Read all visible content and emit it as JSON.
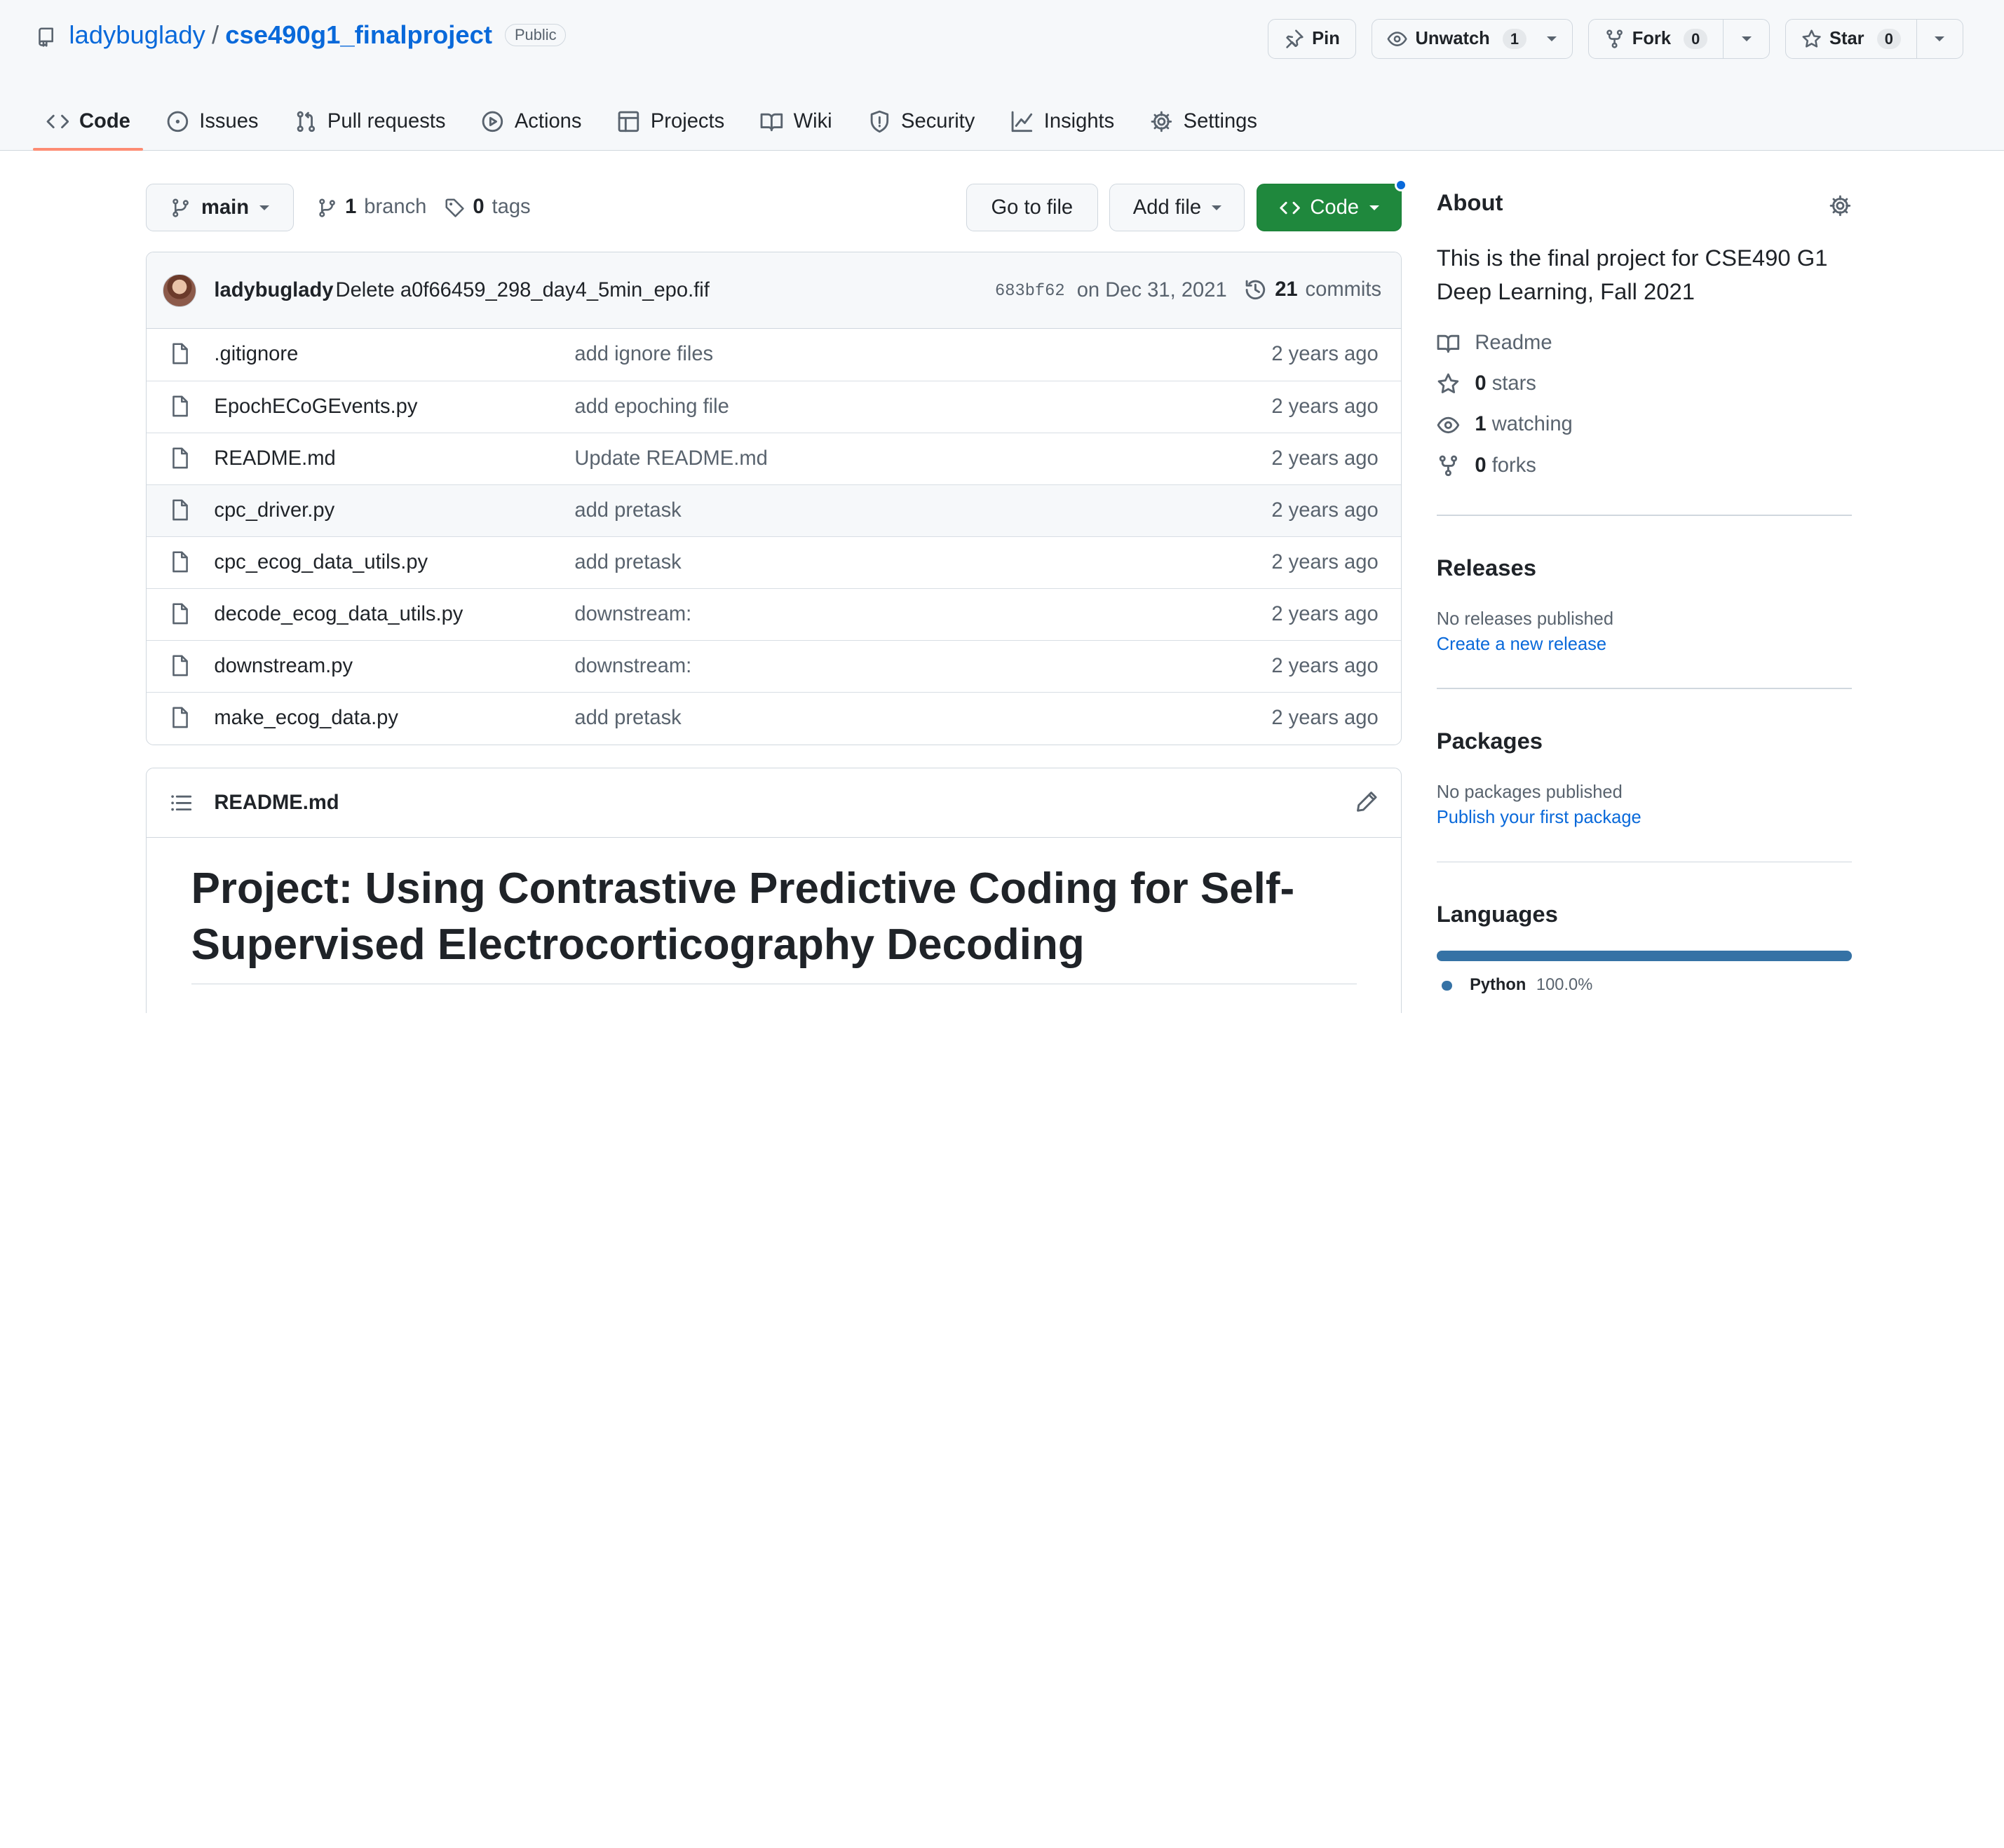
{
  "repo": {
    "owner": "ladybuglady",
    "separator": "/",
    "name": "cse490g1_finalproject",
    "visibility": "Public"
  },
  "actions": {
    "pin": "Pin",
    "unwatch": "Unwatch",
    "unwatch_count": "1",
    "fork": "Fork",
    "fork_count": "0",
    "star": "Star",
    "star_count": "0"
  },
  "tabs": [
    {
      "label": "Code",
      "icon": "code-icon",
      "active": true
    },
    {
      "label": "Issues",
      "icon": "issue-icon"
    },
    {
      "label": "Pull requests",
      "icon": "pull-request-icon"
    },
    {
      "label": "Actions",
      "icon": "play-icon"
    },
    {
      "label": "Projects",
      "icon": "table-icon"
    },
    {
      "label": "Wiki",
      "icon": "book-icon"
    },
    {
      "label": "Security",
      "icon": "shield-icon"
    },
    {
      "label": "Insights",
      "icon": "graph-icon"
    },
    {
      "label": "Settings",
      "icon": "gear-icon"
    }
  ],
  "branchbar": {
    "branch": "main",
    "branch_count": "1",
    "branch_label": "branch",
    "tag_count": "0",
    "tag_label": "tags",
    "goto_file": "Go to file",
    "add_file": "Add file",
    "code": "Code"
  },
  "commit": {
    "author": "ladybuglady",
    "message": "Delete a0f66459_298_day4_5min_epo.fif",
    "sha": "683bf62",
    "date": "on Dec 31, 2021",
    "count": "21",
    "count_label": "commits"
  },
  "files": [
    {
      "name": ".gitignore",
      "message": "add ignore files",
      "age": "2 years ago"
    },
    {
      "name": "EpochECoGEvents.py",
      "message": "add epoching file",
      "age": "2 years ago"
    },
    {
      "name": "README.md",
      "message": "Update README.md",
      "age": "2 years ago"
    },
    {
      "name": "cpc_driver.py",
      "message": "add pretask",
      "age": "2 years ago"
    },
    {
      "name": "cpc_ecog_data_utils.py",
      "message": "add pretask",
      "age": "2 years ago"
    },
    {
      "name": "decode_ecog_data_utils.py",
      "message": "downstream:",
      "age": "2 years ago"
    },
    {
      "name": "downstream.py",
      "message": "downstream:",
      "age": "2 years ago"
    },
    {
      "name": "make_ecog_data.py",
      "message": "add pretask",
      "age": "2 years ago"
    }
  ],
  "readme": {
    "filename": "README.md",
    "heading_line1": "Project: Using Contrastive Predictive Coding for Self-",
    "heading_line2": "Supervised Electrocorticography Decoding"
  },
  "about": {
    "title": "About",
    "description": "This is the final project for CSE490 G1 Deep Learning, Fall 2021",
    "readme": "Readme",
    "stars_count": "0",
    "stars_label": "stars",
    "watching_count": "1",
    "watching_label": "watching",
    "forks_count": "0",
    "forks_label": "forks"
  },
  "releases": {
    "title": "Releases",
    "empty": "No releases published",
    "link": "Create a new release"
  },
  "packages": {
    "title": "Packages",
    "empty": "No packages published",
    "link": "Publish your first package"
  },
  "languages": {
    "title": "Languages",
    "items": [
      {
        "name": "Python",
        "percent": "100.0%",
        "color": "#3572A5",
        "fraction": 1.0
      }
    ]
  },
  "colors": {
    "accent": "#0969da",
    "code_button": "#1f883d",
    "tab_underline": "#fd8c73"
  }
}
